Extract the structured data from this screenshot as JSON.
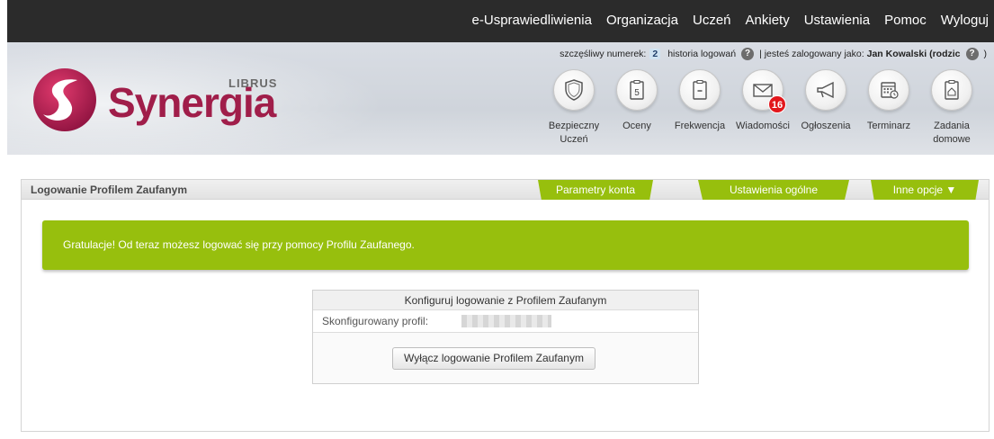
{
  "nav": {
    "items": [
      "e-Usprawiedliwienia",
      "Organizacja",
      "Uczeń",
      "Ankiety",
      "Ustawienia",
      "Pomoc",
      "Wyloguj"
    ]
  },
  "status": {
    "lucky_label": "szczęśliwy numerek:",
    "lucky_number": "2",
    "history_label": "historia logowań",
    "help_glyph": "?",
    "logged_label": "| jesteś zalogowany jako:",
    "user": "Jan Kowalski (rodzic",
    "close_paren": ")"
  },
  "logo": {
    "word": "Synergia",
    "brand": "LIBRUS",
    "icon": "librus-s-logo-icon"
  },
  "modules": [
    {
      "label": "Bezpieczny Uczeń",
      "icon": "shield-icon"
    },
    {
      "label": "Oceny",
      "icon": "grades-icon"
    },
    {
      "label": "Frekwencja",
      "icon": "attendance-icon"
    },
    {
      "label": "Wiadomości",
      "icon": "envelope-icon",
      "badge": "16"
    },
    {
      "label": "Ogłoszenia",
      "icon": "megaphone-icon"
    },
    {
      "label": "Terminarz",
      "icon": "calendar-icon"
    },
    {
      "label": "Zadania domowe",
      "icon": "homework-icon"
    }
  ],
  "panel": {
    "title": "Logowanie Profilem Zaufanym",
    "tabs": [
      "Parametry konta",
      "Ustawienia ogólne",
      "Inne opcje ▼"
    ]
  },
  "message": "Gratulacje! Od teraz możesz logować się przy pomocy Profilu Zaufanego.",
  "config": {
    "title": "Konfiguruj logowanie z Profilem Zaufanym",
    "profile_label": "Skonfigurowany profil:",
    "button": "Wyłącz logowanie Profilem Zaufanym"
  },
  "colors": {
    "accent_green": "#97bf0d",
    "brand_red": "#a01e4a",
    "topbar": "#2b2b2b",
    "badge_red": "#e2171c"
  }
}
